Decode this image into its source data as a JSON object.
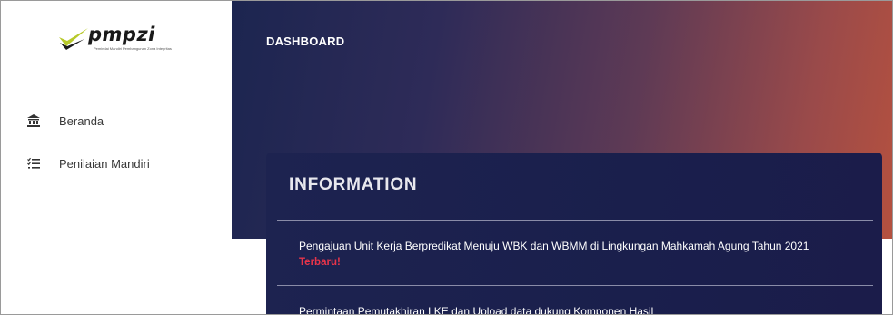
{
  "brand": {
    "name": "pmpzi",
    "tagline": "Pemindai Mandiri Pembangunan Zona Integritas"
  },
  "sidebar": {
    "items": [
      {
        "label": "Beranda",
        "icon": "bank-icon"
      },
      {
        "label": "Penilaian Mandiri",
        "icon": "checklist-icon"
      }
    ]
  },
  "header": {
    "title": "DASHBOARD"
  },
  "info_card": {
    "title": "INFORMATION",
    "items": [
      {
        "text": "Pengajuan Unit Kerja Berpredikat Menuju WBK dan WBMM di Lingkungan Mahkamah Agung Tahun 2021",
        "badge": "Terbaru!"
      },
      {
        "text": "Permintaan Pemutakhiran LKE dan Upload data dukung Komponen Hasil"
      }
    ]
  },
  "colors": {
    "hero_start": "#1c2550",
    "hero_end": "#b5513f",
    "card_bg": "#1d2350",
    "badge": "#e8344a"
  }
}
